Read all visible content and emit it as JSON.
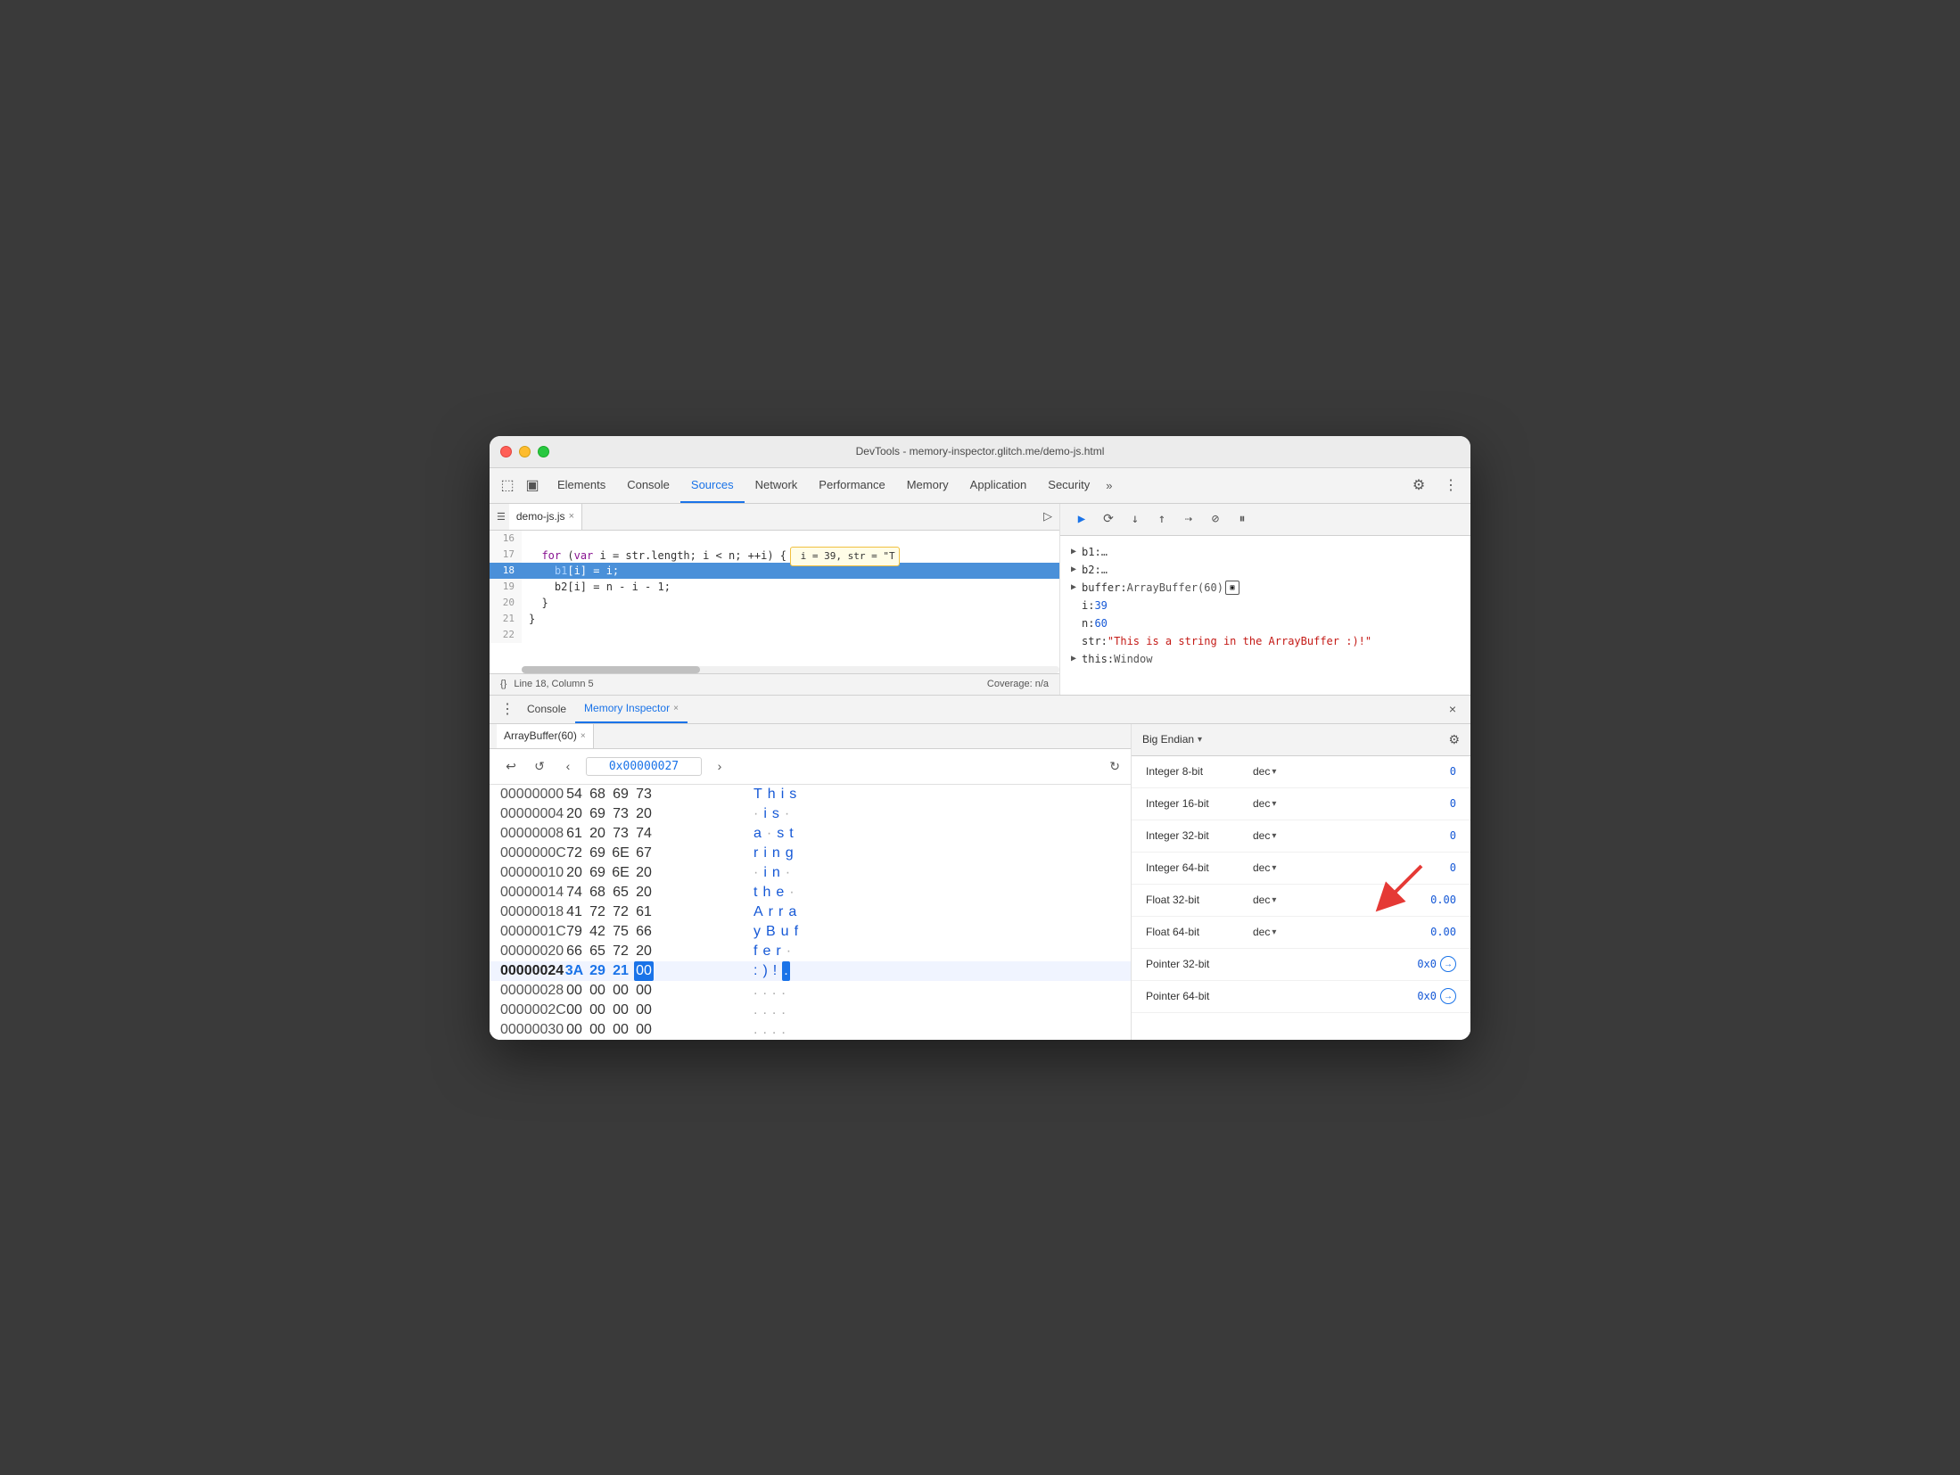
{
  "window": {
    "title": "DevTools - memory-inspector.glitch.me/demo-js.html"
  },
  "devtools_tabs": {
    "items": [
      {
        "label": "Elements",
        "active": false
      },
      {
        "label": "Console",
        "active": false
      },
      {
        "label": "Sources",
        "active": true
      },
      {
        "label": "Network",
        "active": false
      },
      {
        "label": "Performance",
        "active": false
      },
      {
        "label": "Memory",
        "active": false
      },
      {
        "label": "Application",
        "active": false
      },
      {
        "label": "Security",
        "active": false
      }
    ],
    "more_label": "»"
  },
  "editor": {
    "file_tab": "demo-js.js",
    "lines": [
      {
        "num": "16",
        "content": "",
        "highlighted": false
      },
      {
        "num": "17",
        "content": "  for (var i = str.length; i < n; ++i) {",
        "highlighted": false,
        "tooltip": " i = 39, str = \"T"
      },
      {
        "num": "18",
        "content": "    b1[i] = i;",
        "highlighted": true
      },
      {
        "num": "19",
        "content": "    b2[i] = n - i - 1;",
        "highlighted": false
      },
      {
        "num": "20",
        "content": "  }",
        "highlighted": false
      },
      {
        "num": "21",
        "content": "}",
        "highlighted": false
      },
      {
        "num": "22",
        "content": "",
        "highlighted": false
      }
    ],
    "status_line": "Line 18, Column 5",
    "status_coverage": "Coverage: n/a"
  },
  "scope": {
    "b1_label": "b1",
    "b1_val": "…",
    "b2_label": "b2",
    "b2_val": "…",
    "buffer_label": "buffer",
    "buffer_val": "ArrayBuffer(60)",
    "i_label": "i",
    "i_val": "39",
    "n_label": "n",
    "n_val": "60",
    "str_label": "str",
    "str_val": "\"This is a string in the ArrayBuffer :)!\"",
    "this_label": "this",
    "this_val": "Window"
  },
  "bottom_tabs": {
    "console_label": "Console",
    "memory_inspector_label": "Memory Inspector"
  },
  "array_buffer_tab": {
    "label": "ArrayBuffer(60)"
  },
  "nav": {
    "address": "0x00000027",
    "back_label": "‹",
    "forward_label": "›",
    "undo_label": "↩",
    "redo_label": "↺"
  },
  "hex_rows": [
    {
      "addr": "00000000",
      "bytes": [
        "54",
        "68",
        "69",
        "73"
      ],
      "chars": [
        "T",
        "h",
        "i",
        "s"
      ]
    },
    {
      "addr": "00000004",
      "bytes": [
        "20",
        "69",
        "73",
        "20"
      ],
      "chars": [
        " ",
        "i",
        "s",
        " "
      ]
    },
    {
      "addr": "00000008",
      "bytes": [
        "61",
        "20",
        "73",
        "74"
      ],
      "chars": [
        "a",
        " ",
        "s",
        "t"
      ]
    },
    {
      "addr": "0000000C",
      "bytes": [
        "72",
        "69",
        "6E",
        "67"
      ],
      "chars": [
        "r",
        "i",
        "n",
        "g"
      ]
    },
    {
      "addr": "00000010",
      "bytes": [
        "20",
        "69",
        "6E",
        "20"
      ],
      "chars": [
        " ",
        "i",
        "n",
        " "
      ]
    },
    {
      "addr": "00000014",
      "bytes": [
        "74",
        "68",
        "65",
        "20"
      ],
      "chars": [
        "t",
        "h",
        "e",
        " "
      ]
    },
    {
      "addr": "00000018",
      "bytes": [
        "41",
        "72",
        "72",
        "61"
      ],
      "chars": [
        "A",
        "r",
        "r",
        "a"
      ]
    },
    {
      "addr": "0000001C",
      "bytes": [
        "79",
        "42",
        "75",
        "66"
      ],
      "chars": [
        "y",
        "B",
        "u",
        "f"
      ]
    },
    {
      "addr": "00000020",
      "bytes": [
        "66",
        "65",
        "72",
        "20"
      ],
      "chars": [
        "f",
        "e",
        "r",
        " "
      ]
    },
    {
      "addr": "00000024",
      "bytes": [
        "3A",
        "29",
        "21",
        "00"
      ],
      "chars": [
        ":",
        ")",
        " ",
        "."
      ],
      "highlighted": true,
      "selected_byte": 3
    },
    {
      "addr": "00000028",
      "bytes": [
        "00",
        "00",
        "00",
        "00"
      ],
      "chars": [
        ".",
        ".",
        ".",
        "."
      ]
    },
    {
      "addr": "0000002C",
      "bytes": [
        "00",
        "00",
        "00",
        "00"
      ],
      "chars": [
        ".",
        ".",
        ".",
        "."
      ]
    },
    {
      "addr": "00000030",
      "bytes": [
        "00",
        "00",
        "00",
        "00"
      ],
      "chars": [
        ".",
        ".",
        ".",
        "."
      ]
    }
  ],
  "endian": {
    "label": "Big Endian",
    "arrow": "▾"
  },
  "value_rows": [
    {
      "type": "Integer 8-bit",
      "format": "dec",
      "value": "0"
    },
    {
      "type": "Integer 16-bit",
      "format": "dec",
      "value": "0"
    },
    {
      "type": "Integer 32-bit",
      "format": "dec",
      "value": "0"
    },
    {
      "type": "Integer 64-bit",
      "format": "dec",
      "value": "0"
    },
    {
      "type": "Float 32-bit",
      "format": "dec",
      "value": "0.00"
    },
    {
      "type": "Float 64-bit",
      "format": "dec",
      "value": "0.00"
    },
    {
      "type": "Pointer 32-bit",
      "format": "",
      "value": "0x0",
      "link": true
    },
    {
      "type": "Pointer 64-bit",
      "format": "",
      "value": "0x0",
      "link": true
    }
  ]
}
